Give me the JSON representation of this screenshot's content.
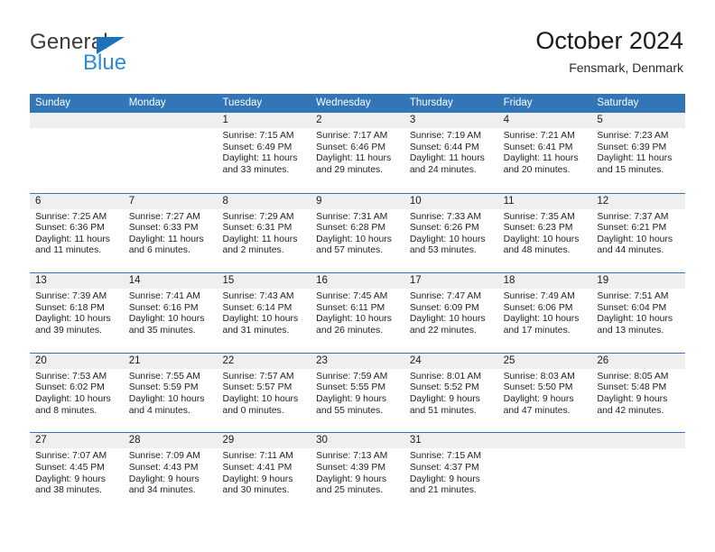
{
  "brand": {
    "name_top": "General",
    "name_bottom": "Blue",
    "triangle_color": "#1c71b9",
    "blue_color": "#2e8ad6"
  },
  "header": {
    "title": "October 2024",
    "subtitle": "Fensmark, Denmark"
  },
  "theme": {
    "header_blue": "#3276b8",
    "daynum_gray": "#efefef",
    "text": "#222222"
  },
  "weekdays": [
    "Sunday",
    "Monday",
    "Tuesday",
    "Wednesday",
    "Thursday",
    "Friday",
    "Saturday"
  ],
  "labels": {
    "sunrise": "Sunrise:",
    "sunset": "Sunset:",
    "daylight": "Daylight:"
  },
  "weeks": [
    [
      {
        "day": "",
        "empty": true
      },
      {
        "day": "",
        "empty": true
      },
      {
        "day": "1",
        "sunrise": "Sunrise: 7:15 AM",
        "sunset": "Sunset: 6:49 PM",
        "daylight_1": "Daylight: 11 hours",
        "daylight_2": "and 33 minutes."
      },
      {
        "day": "2",
        "sunrise": "Sunrise: 7:17 AM",
        "sunset": "Sunset: 6:46 PM",
        "daylight_1": "Daylight: 11 hours",
        "daylight_2": "and 29 minutes."
      },
      {
        "day": "3",
        "sunrise": "Sunrise: 7:19 AM",
        "sunset": "Sunset: 6:44 PM",
        "daylight_1": "Daylight: 11 hours",
        "daylight_2": "and 24 minutes."
      },
      {
        "day": "4",
        "sunrise": "Sunrise: 7:21 AM",
        "sunset": "Sunset: 6:41 PM",
        "daylight_1": "Daylight: 11 hours",
        "daylight_2": "and 20 minutes."
      },
      {
        "day": "5",
        "sunrise": "Sunrise: 7:23 AM",
        "sunset": "Sunset: 6:39 PM",
        "daylight_1": "Daylight: 11 hours",
        "daylight_2": "and 15 minutes."
      }
    ],
    [
      {
        "day": "6",
        "sunrise": "Sunrise: 7:25 AM",
        "sunset": "Sunset: 6:36 PM",
        "daylight_1": "Daylight: 11 hours",
        "daylight_2": "and 11 minutes."
      },
      {
        "day": "7",
        "sunrise": "Sunrise: 7:27 AM",
        "sunset": "Sunset: 6:33 PM",
        "daylight_1": "Daylight: 11 hours",
        "daylight_2": "and 6 minutes."
      },
      {
        "day": "8",
        "sunrise": "Sunrise: 7:29 AM",
        "sunset": "Sunset: 6:31 PM",
        "daylight_1": "Daylight: 11 hours",
        "daylight_2": "and 2 minutes."
      },
      {
        "day": "9",
        "sunrise": "Sunrise: 7:31 AM",
        "sunset": "Sunset: 6:28 PM",
        "daylight_1": "Daylight: 10 hours",
        "daylight_2": "and 57 minutes."
      },
      {
        "day": "10",
        "sunrise": "Sunrise: 7:33 AM",
        "sunset": "Sunset: 6:26 PM",
        "daylight_1": "Daylight: 10 hours",
        "daylight_2": "and 53 minutes."
      },
      {
        "day": "11",
        "sunrise": "Sunrise: 7:35 AM",
        "sunset": "Sunset: 6:23 PM",
        "daylight_1": "Daylight: 10 hours",
        "daylight_2": "and 48 minutes."
      },
      {
        "day": "12",
        "sunrise": "Sunrise: 7:37 AM",
        "sunset": "Sunset: 6:21 PM",
        "daylight_1": "Daylight: 10 hours",
        "daylight_2": "and 44 minutes."
      }
    ],
    [
      {
        "day": "13",
        "sunrise": "Sunrise: 7:39 AM",
        "sunset": "Sunset: 6:18 PM",
        "daylight_1": "Daylight: 10 hours",
        "daylight_2": "and 39 minutes."
      },
      {
        "day": "14",
        "sunrise": "Sunrise: 7:41 AM",
        "sunset": "Sunset: 6:16 PM",
        "daylight_1": "Daylight: 10 hours",
        "daylight_2": "and 35 minutes."
      },
      {
        "day": "15",
        "sunrise": "Sunrise: 7:43 AM",
        "sunset": "Sunset: 6:14 PM",
        "daylight_1": "Daylight: 10 hours",
        "daylight_2": "and 31 minutes."
      },
      {
        "day": "16",
        "sunrise": "Sunrise: 7:45 AM",
        "sunset": "Sunset: 6:11 PM",
        "daylight_1": "Daylight: 10 hours",
        "daylight_2": "and 26 minutes."
      },
      {
        "day": "17",
        "sunrise": "Sunrise: 7:47 AM",
        "sunset": "Sunset: 6:09 PM",
        "daylight_1": "Daylight: 10 hours",
        "daylight_2": "and 22 minutes."
      },
      {
        "day": "18",
        "sunrise": "Sunrise: 7:49 AM",
        "sunset": "Sunset: 6:06 PM",
        "daylight_1": "Daylight: 10 hours",
        "daylight_2": "and 17 minutes."
      },
      {
        "day": "19",
        "sunrise": "Sunrise: 7:51 AM",
        "sunset": "Sunset: 6:04 PM",
        "daylight_1": "Daylight: 10 hours",
        "daylight_2": "and 13 minutes."
      }
    ],
    [
      {
        "day": "20",
        "sunrise": "Sunrise: 7:53 AM",
        "sunset": "Sunset: 6:02 PM",
        "daylight_1": "Daylight: 10 hours",
        "daylight_2": "and 8 minutes."
      },
      {
        "day": "21",
        "sunrise": "Sunrise: 7:55 AM",
        "sunset": "Sunset: 5:59 PM",
        "daylight_1": "Daylight: 10 hours",
        "daylight_2": "and 4 minutes."
      },
      {
        "day": "22",
        "sunrise": "Sunrise: 7:57 AM",
        "sunset": "Sunset: 5:57 PM",
        "daylight_1": "Daylight: 10 hours",
        "daylight_2": "and 0 minutes."
      },
      {
        "day": "23",
        "sunrise": "Sunrise: 7:59 AM",
        "sunset": "Sunset: 5:55 PM",
        "daylight_1": "Daylight: 9 hours",
        "daylight_2": "and 55 minutes."
      },
      {
        "day": "24",
        "sunrise": "Sunrise: 8:01 AM",
        "sunset": "Sunset: 5:52 PM",
        "daylight_1": "Daylight: 9 hours",
        "daylight_2": "and 51 minutes."
      },
      {
        "day": "25",
        "sunrise": "Sunrise: 8:03 AM",
        "sunset": "Sunset: 5:50 PM",
        "daylight_1": "Daylight: 9 hours",
        "daylight_2": "and 47 minutes."
      },
      {
        "day": "26",
        "sunrise": "Sunrise: 8:05 AM",
        "sunset": "Sunset: 5:48 PM",
        "daylight_1": "Daylight: 9 hours",
        "daylight_2": "and 42 minutes."
      }
    ],
    [
      {
        "day": "27",
        "sunrise": "Sunrise: 7:07 AM",
        "sunset": "Sunset: 4:45 PM",
        "daylight_1": "Daylight: 9 hours",
        "daylight_2": "and 38 minutes."
      },
      {
        "day": "28",
        "sunrise": "Sunrise: 7:09 AM",
        "sunset": "Sunset: 4:43 PM",
        "daylight_1": "Daylight: 9 hours",
        "daylight_2": "and 34 minutes."
      },
      {
        "day": "29",
        "sunrise": "Sunrise: 7:11 AM",
        "sunset": "Sunset: 4:41 PM",
        "daylight_1": "Daylight: 9 hours",
        "daylight_2": "and 30 minutes."
      },
      {
        "day": "30",
        "sunrise": "Sunrise: 7:13 AM",
        "sunset": "Sunset: 4:39 PM",
        "daylight_1": "Daylight: 9 hours",
        "daylight_2": "and 25 minutes."
      },
      {
        "day": "31",
        "sunrise": "Sunrise: 7:15 AM",
        "sunset": "Sunset: 4:37 PM",
        "daylight_1": "Daylight: 9 hours",
        "daylight_2": "and 21 minutes."
      },
      {
        "day": "",
        "empty": true
      },
      {
        "day": "",
        "empty": true
      }
    ]
  ]
}
